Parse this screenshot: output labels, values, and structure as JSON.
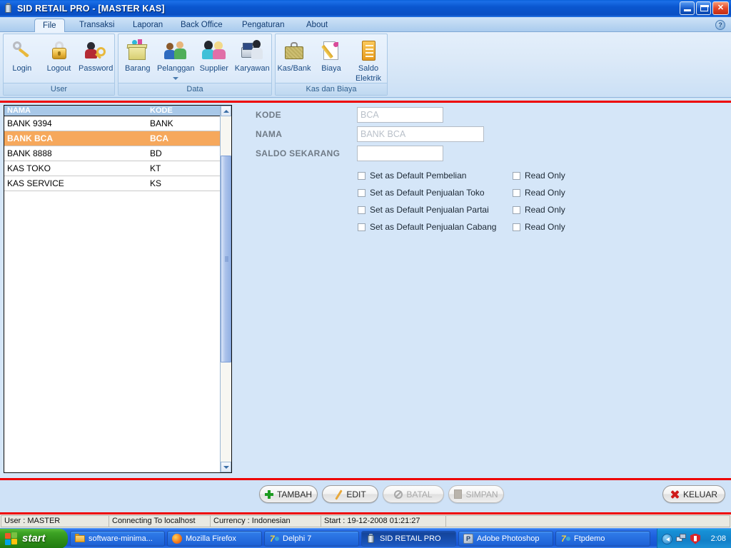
{
  "window": {
    "title": "SID RETAIL PRO - [MASTER KAS]",
    "icon": "app-icon",
    "minimize_label": "_",
    "restore_label": "❐",
    "close_label": "✕"
  },
  "menu": {
    "tabs": [
      {
        "label": "File",
        "active": true
      },
      {
        "label": "Transaksi",
        "active": false
      },
      {
        "label": "Laporan",
        "active": false
      },
      {
        "label": "Back Office",
        "active": false
      },
      {
        "label": "Pengaturan",
        "active": false
      },
      {
        "label": "About",
        "active": false
      }
    ],
    "help_label": "?"
  },
  "ribbon": {
    "groups": [
      {
        "title": "User",
        "items": [
          {
            "label": "Login",
            "icon": "key-icon"
          },
          {
            "label": "Logout",
            "icon": "padlock-icon"
          },
          {
            "label": "Password",
            "icon": "user-key-icon"
          }
        ]
      },
      {
        "title": "Data",
        "items": [
          {
            "label": "Barang",
            "icon": "box-icon"
          },
          {
            "label": "Pelanggan",
            "icon": "customers-icon",
            "has_dropdown": true
          },
          {
            "label": "Supplier",
            "icon": "supplier-icon"
          },
          {
            "label": "Karyawan",
            "icon": "employee-icon"
          }
        ]
      },
      {
        "title": "Kas dan Biaya",
        "items": [
          {
            "label": "Kas/Bank",
            "icon": "briefcase-icon"
          },
          {
            "label": "Biaya",
            "icon": "document-pencil-icon"
          },
          {
            "label": "Saldo\nElektrik",
            "label_line1": "Saldo",
            "label_line2": "Elektrik",
            "icon": "electric-balance-icon"
          }
        ]
      }
    ]
  },
  "list": {
    "columns": [
      "NAMA",
      "KODE"
    ],
    "rows": [
      {
        "nama": "BANK 9394",
        "kode": "BANK",
        "selected": false
      },
      {
        "nama": "BANK BCA",
        "kode": "BCA",
        "selected": true
      },
      {
        "nama": "BANK 8888",
        "kode": "BD",
        "selected": false
      },
      {
        "nama": "KAS TOKO",
        "kode": "KT",
        "selected": false
      },
      {
        "nama": "KAS SERVICE",
        "kode": "KS",
        "selected": false
      }
    ],
    "scrollbar": {
      "up_arrow": "▲",
      "down_arrow": "▼"
    }
  },
  "form": {
    "fields": [
      {
        "label": "KODE",
        "value": "BCA"
      },
      {
        "label": "NAMA",
        "value": "BANK BCA"
      },
      {
        "label": "SALDO SEKARANG",
        "value": ""
      }
    ],
    "checkbox_rows": [
      {
        "label": "Set as Default Pembelian",
        "checked": false,
        "readonly_label": "Read Only",
        "readonly_checked": false
      },
      {
        "label": "Set as Default Penjualan Toko",
        "checked": false,
        "readonly_label": "Read Only",
        "readonly_checked": false
      },
      {
        "label": "Set as Default Penjualan Partai",
        "checked": false,
        "readonly_label": "Read Only",
        "readonly_checked": false
      },
      {
        "label": "Set as Default Penjualan Cabang",
        "checked": false,
        "readonly_label": "Read Only",
        "readonly_checked": false
      }
    ]
  },
  "actions": {
    "buttons": [
      {
        "label": "TAMBAH",
        "icon": "plus-icon",
        "enabled": true
      },
      {
        "label": "EDIT",
        "icon": "pencil-icon",
        "enabled": true
      },
      {
        "label": "BATAL",
        "icon": "cancel-icon",
        "enabled": false
      },
      {
        "label": "SIMPAN",
        "icon": "save-icon",
        "enabled": false
      }
    ],
    "exit": {
      "label": "KELUAR",
      "icon": "red-x-icon",
      "enabled": true
    }
  },
  "statusbar": {
    "cells": [
      "User : MASTER",
      "Connecting To localhost",
      "Currency : Indonesian",
      "Start  : 19-12-2008 01:21:27",
      ""
    ]
  },
  "taskbar": {
    "start_label": "start",
    "tasks": [
      {
        "label": "software-minima...",
        "icon": "folder-icon",
        "active": false
      },
      {
        "label": "Mozilla Firefox",
        "icon": "firefox-icon",
        "active": false
      },
      {
        "label": "Delphi 7",
        "icon": "delphi-icon",
        "active": false
      },
      {
        "label": "SID RETAIL PRO",
        "icon": "app-icon",
        "active": true
      },
      {
        "label": "Adobe Photoshop",
        "icon": "photoshop-icon",
        "active": false
      },
      {
        "label": "Ftpdemo",
        "icon": "delphi-icon",
        "active": false
      }
    ],
    "tray": {
      "chevron": "show-hidden-icons",
      "icons": [
        "network-icon",
        "security-shield-icon"
      ],
      "clock": "2:08"
    }
  },
  "colors": {
    "titlebar_blue": "#0a56cf",
    "accent_red": "#ee0000",
    "selection_orange": "#f6a85c",
    "client_bg": "#d5e6f8",
    "header_blue": "#a8c8e8"
  }
}
